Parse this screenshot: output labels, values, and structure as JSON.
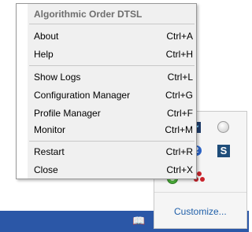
{
  "context_menu": {
    "header": "Algorithmic Order DTSL",
    "groups": [
      [
        {
          "label": "About",
          "shortcut": "Ctrl+A"
        },
        {
          "label": "Help",
          "shortcut": "Ctrl+H"
        }
      ],
      [
        {
          "label": "Show Logs",
          "shortcut": "Ctrl+L"
        },
        {
          "label": "Configuration Manager",
          "shortcut": "Ctrl+G"
        },
        {
          "label": "Profile Manager",
          "shortcut": "Ctrl+F"
        },
        {
          "label": "Monitor",
          "shortcut": "Ctrl+M"
        }
      ],
      [
        {
          "label": "Restart",
          "shortcut": "Ctrl+R"
        },
        {
          "label": "Close",
          "shortcut": "Ctrl+X"
        }
      ]
    ]
  },
  "tray_flyout": {
    "customize_label": "Customize...",
    "icons": [
      "chart-icon",
      "circle-icon",
      "blue-2-icon",
      "s-app-icon",
      "green-status-icon",
      "red-dots-icon"
    ]
  },
  "taskbar": {
    "icon": "book-icon",
    "color": "#2b57a7"
  }
}
